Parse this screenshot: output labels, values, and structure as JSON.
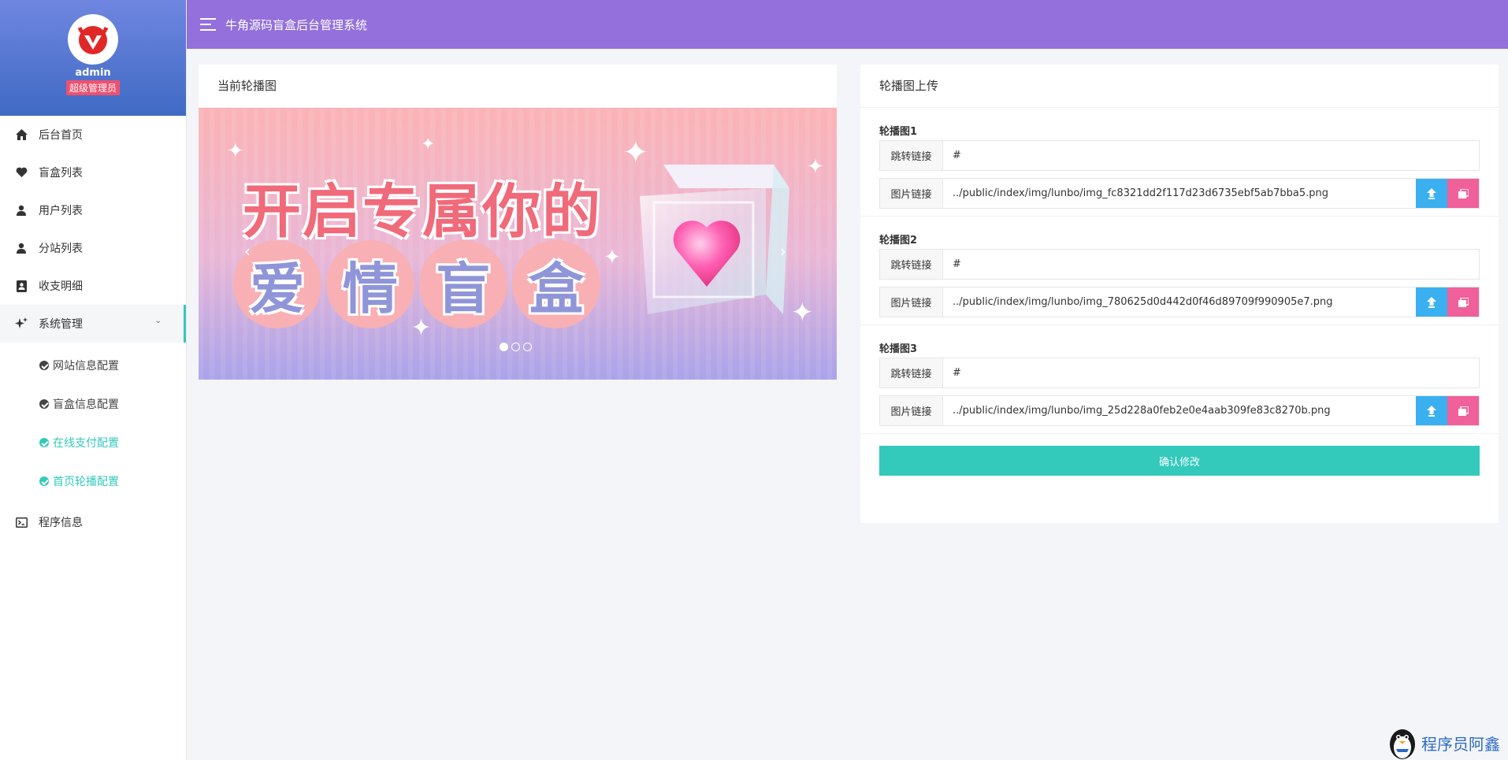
{
  "sidebar": {
    "profile": {
      "name": "admin",
      "role": "超级管理员"
    },
    "menu": [
      {
        "label": "后台首页",
        "icon": "home-icon"
      },
      {
        "label": "盲盒列表",
        "icon": "heart-icon"
      },
      {
        "label": "用户列表",
        "icon": "user-icon"
      },
      {
        "label": "分站列表",
        "icon": "user-icon"
      },
      {
        "label": "收支明细",
        "icon": "contact-book-icon"
      },
      {
        "label": "系统管理",
        "icon": "sparkle-icon",
        "expanded": true
      },
      {
        "label": "程序信息",
        "icon": "terminal-icon"
      }
    ],
    "submenu": [
      {
        "label": "网站信息配置",
        "active": false
      },
      {
        "label": "盲盒信息配置",
        "active": false
      },
      {
        "label": "在线支付配置",
        "active": true
      },
      {
        "label": "首页轮播配置",
        "active": true
      }
    ]
  },
  "header": {
    "title": "牛角源码盲盒后台管理系统"
  },
  "left_card": {
    "title": "当前轮播图",
    "banner": {
      "line1": "开启专属你的",
      "line2": [
        "爱",
        "情",
        "盲",
        "盒"
      ],
      "slides": 3,
      "active_slide": 1
    }
  },
  "right_card": {
    "title": "轮播图上传",
    "groups": [
      {
        "title": "轮播图1",
        "link_label": "跳转链接",
        "link_value": "#",
        "img_label": "图片链接",
        "img_value": "../public/index/img/lunbo/img_fc8321dd2f117d23d6735ebf5ab7bba5.png"
      },
      {
        "title": "轮播图2",
        "link_label": "跳转链接",
        "link_value": "#",
        "img_label": "图片链接",
        "img_value": "../public/index/img/lunbo/img_780625d0d442d0f46d89709f990905e7.png"
      },
      {
        "title": "轮播图3",
        "link_label": "跳转链接",
        "link_value": "#",
        "img_label": "图片链接",
        "img_value": "../public/index/img/lunbo/img_25d228a0feb2e0e4aab309fe83c8270b.png"
      }
    ],
    "confirm_label": "确认修改"
  },
  "watermark": {
    "text": "程序员阿鑫"
  },
  "colors": {
    "header": "#9370db",
    "accent": "#33c9bb",
    "upload_button": "#3ab0f0",
    "gallery_button": "#f0609a",
    "role_badge": "#f0506e"
  }
}
